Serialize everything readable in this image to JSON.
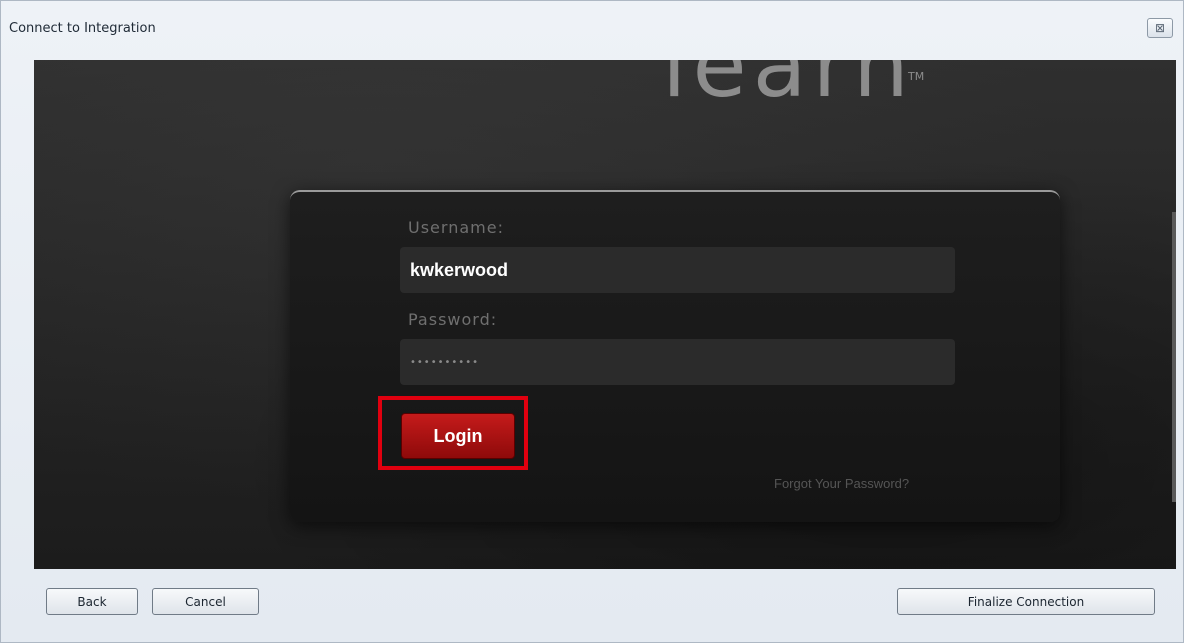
{
  "window": {
    "title": "Connect to Integration",
    "close_glyph": "⊠"
  },
  "hero": {
    "logo_fragment": "learn",
    "logo_tm": "TM"
  },
  "login": {
    "username_label": "Username:",
    "username_value": "kwkerwood",
    "password_label": "Password:",
    "password_value": "••••••••••",
    "login_label": "Login",
    "forgot_label": "Forgot Your Password?"
  },
  "footer": {
    "back_label": "Back",
    "cancel_label": "Cancel",
    "finalize_label": "Finalize Connection"
  },
  "colors": {
    "highlight": "#e0000f",
    "login_button": "#b01212"
  }
}
